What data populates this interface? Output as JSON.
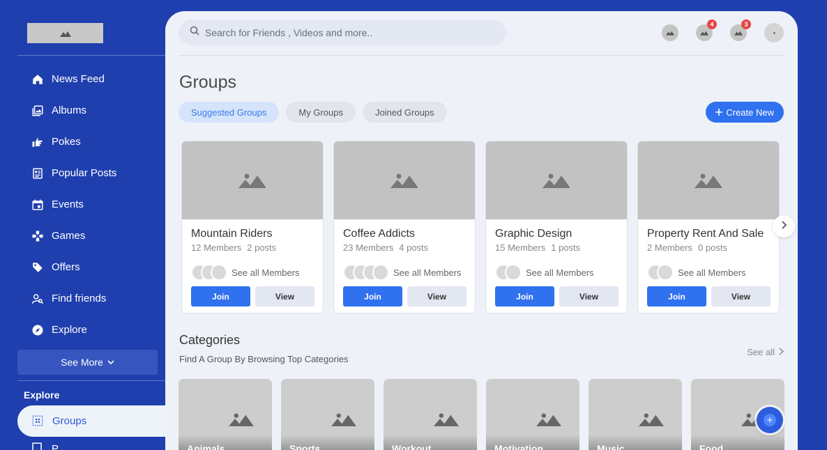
{
  "sidebar": {
    "nav_items": [
      {
        "label": "News Feed",
        "icon": "home-icon"
      },
      {
        "label": "Albums",
        "icon": "albums-icon"
      },
      {
        "label": "Pokes",
        "icon": "poke-icon"
      },
      {
        "label": "Popular Posts",
        "icon": "popular-posts-icon"
      },
      {
        "label": "Events",
        "icon": "calendar-icon"
      },
      {
        "label": "Games",
        "icon": "gamepad-icon"
      },
      {
        "label": "Offers",
        "icon": "tag-icon"
      },
      {
        "label": "Find friends",
        "icon": "find-friends-icon"
      },
      {
        "label": "Explore",
        "icon": "compass-icon"
      }
    ],
    "see_more": "See More",
    "explore_heading": "Explore",
    "active_item": "Groups",
    "next_item": "P"
  },
  "header": {
    "search_placeholder": "Search for Friends , Videos and more..",
    "badges": {
      "messages": "4",
      "notifications": "3"
    }
  },
  "page": {
    "title": "Groups",
    "tabs": [
      "Suggested Groups",
      "My Groups",
      "Joined Groups"
    ],
    "create_label": "Create New"
  },
  "groups": [
    {
      "name": "Mountain Riders",
      "members": "12 Members",
      "posts": "2 posts",
      "see_all": "See all Members",
      "join": "Join",
      "view": "View"
    },
    {
      "name": "Coffee Addicts",
      "members": "23 Members",
      "posts": "4 posts",
      "see_all": "See all Members",
      "join": "Join",
      "view": "View"
    },
    {
      "name": "Graphic Design",
      "members": "15 Members",
      "posts": "1 posts",
      "see_all": "See all Members",
      "join": "Join",
      "view": "View"
    },
    {
      "name": "Property Rent And Sale",
      "members": "2 Members",
      "posts": "0 posts",
      "see_all": "See all Members",
      "join": "Join",
      "view": "View"
    }
  ],
  "categories": {
    "title": "Categories",
    "subtitle": "Find A Group By Browsing Top Categories",
    "see_all": "See all",
    "items": [
      "Animals",
      "Sports",
      "Workout",
      "Motivation",
      "Music",
      "Food"
    ]
  },
  "colors": {
    "sidebar_bg": "#1f3fae",
    "accent": "#2f71ee",
    "badge": "#e74545"
  }
}
